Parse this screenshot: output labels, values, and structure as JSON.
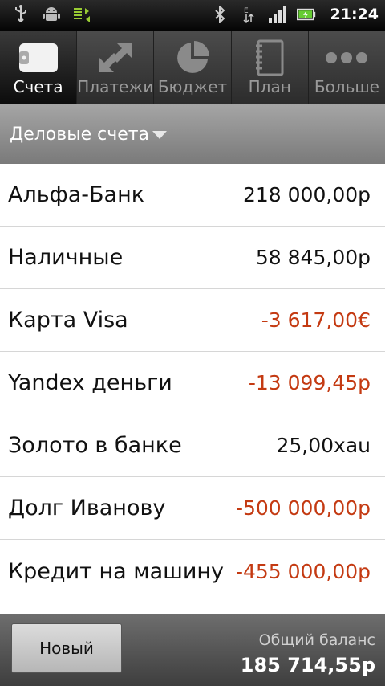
{
  "statusbar": {
    "time": "21:24",
    "icons": [
      "usb-icon",
      "android-debug-icon",
      "sync-icon",
      "bluetooth-icon",
      "edge-data-icon",
      "signal-icon",
      "battery-charging-icon"
    ]
  },
  "tabs": [
    {
      "label": "Счета",
      "icon": "wallet-icon",
      "active": true
    },
    {
      "label": "Платежи",
      "icon": "transfer-arrows-icon",
      "active": false
    },
    {
      "label": "Бюджет",
      "icon": "pie-chart-icon",
      "active": false
    },
    {
      "label": "План",
      "icon": "notebook-icon",
      "active": false
    },
    {
      "label": "Больше",
      "icon": "more-dots-icon",
      "active": false
    }
  ],
  "group": {
    "label": "Деловые счета",
    "icon": "dropdown-caret-icon"
  },
  "accounts": [
    {
      "name": "Альфа-Банк",
      "amount": "218 000,00р",
      "negative": false
    },
    {
      "name": "Наличные",
      "amount": "58 845,00р",
      "negative": false
    },
    {
      "name": "Карта Visa",
      "amount": "-3 617,00€",
      "negative": true
    },
    {
      "name": "Yandex деньги",
      "amount": "-13 099,45р",
      "negative": true
    },
    {
      "name": "Золото в банке",
      "amount": "25,00xau",
      "negative": false
    },
    {
      "name": "Долг Иванову",
      "amount": "-500 000,00р",
      "negative": true
    },
    {
      "name": "Кредит на машину",
      "amount": "-455 000,00р",
      "negative": true
    }
  ],
  "footer": {
    "new_label": "Новый",
    "balance_label": "Общий баланс",
    "balance_value": "185 714,55р"
  },
  "colors": {
    "negative": "#c43a12",
    "positive": "#111111"
  }
}
